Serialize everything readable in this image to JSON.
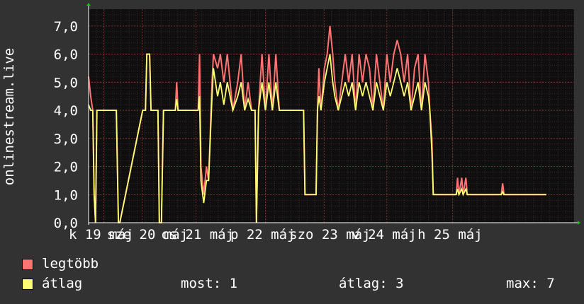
{
  "chart_data": {
    "type": "area",
    "ylabel": "onlinestream.live",
    "ylim": [
      0,
      7.6
    ],
    "yticks": [
      0,
      1,
      2,
      3,
      4,
      5,
      6,
      7
    ],
    "ytick_labels": [
      "0,0",
      "1,0",
      "2,0",
      "3,0",
      "4,0",
      "5,0",
      "6,0",
      "7,0"
    ],
    "xlim": [
      0,
      7.0
    ],
    "xtick_labels": [
      {
        "x": 0.02,
        "label": "k 19 máj"
      },
      {
        "x": 0.57,
        "label": "sze 20 máj"
      },
      {
        "x": 1.35,
        "label": "cs 21 máj"
      },
      {
        "x": 2.35,
        "label": "p 22 máj"
      },
      {
        "x": 3.2,
        "label": "szo 23 máj"
      },
      {
        "x": 4.1,
        "label": "v 24 máj"
      },
      {
        "x": 5.05,
        "label": "h 25 máj"
      }
    ],
    "grid": true,
    "colors": {
      "legtobb": "#ff7373",
      "atlag": "#ffff73"
    },
    "series": [
      {
        "name": "legtöbb",
        "color": "#ff7373",
        "points": [
          [
            0.0,
            5.2
          ],
          [
            0.03,
            4.5
          ],
          [
            0.06,
            4.0
          ],
          [
            0.08,
            1.0
          ],
          [
            0.1,
            0.0
          ],
          [
            0.12,
            4.0
          ],
          [
            0.4,
            4.0
          ],
          [
            0.43,
            0.0
          ],
          [
            0.45,
            0.0
          ],
          [
            0.78,
            4.0
          ],
          [
            0.82,
            4.0
          ],
          [
            0.84,
            6.0
          ],
          [
            0.88,
            6.0
          ],
          [
            0.9,
            4.0
          ],
          [
            1.0,
            4.0
          ],
          [
            1.02,
            0.0
          ],
          [
            1.05,
            0.0
          ],
          [
            1.08,
            4.0
          ],
          [
            1.25,
            4.0
          ],
          [
            1.27,
            5.0
          ],
          [
            1.29,
            4.0
          ],
          [
            1.58,
            4.0
          ],
          [
            1.6,
            6.0
          ],
          [
            1.62,
            2.0
          ],
          [
            1.66,
            1.0
          ],
          [
            1.7,
            2.0
          ],
          [
            1.73,
            1.5
          ],
          [
            1.78,
            5.0
          ],
          [
            1.8,
            6.0
          ],
          [
            1.86,
            5.5
          ],
          [
            1.9,
            6.0
          ],
          [
            1.95,
            5.0
          ],
          [
            2.0,
            6.0
          ],
          [
            2.08,
            4.0
          ],
          [
            2.15,
            5.0
          ],
          [
            2.2,
            6.0
          ],
          [
            2.25,
            4.0
          ],
          [
            2.3,
            5.0
          ],
          [
            2.35,
            4.0
          ],
          [
            2.4,
            4.0
          ],
          [
            2.42,
            0.0
          ],
          [
            2.45,
            4.0
          ],
          [
            2.5,
            6.0
          ],
          [
            2.55,
            4.0
          ],
          [
            2.6,
            6.0
          ],
          [
            2.65,
            4.0
          ],
          [
            2.7,
            6.0
          ],
          [
            2.75,
            4.0
          ],
          [
            3.1,
            4.0
          ],
          [
            3.12,
            1.0
          ],
          [
            3.28,
            1.0
          ],
          [
            3.3,
            4.0
          ],
          [
            3.32,
            5.5
          ],
          [
            3.35,
            4.0
          ],
          [
            3.4,
            5.5
          ],
          [
            3.44,
            6.0
          ],
          [
            3.48,
            7.0
          ],
          [
            3.52,
            6.0
          ],
          [
            3.55,
            5.0
          ],
          [
            3.6,
            4.0
          ],
          [
            3.65,
            5.0
          ],
          [
            3.7,
            6.0
          ],
          [
            3.75,
            5.0
          ],
          [
            3.8,
            6.0
          ],
          [
            3.85,
            4.0
          ],
          [
            3.9,
            6.0
          ],
          [
            3.95,
            5.0
          ],
          [
            4.0,
            6.0
          ],
          [
            4.05,
            5.5
          ],
          [
            4.1,
            4.0
          ],
          [
            4.15,
            6.0
          ],
          [
            4.2,
            5.0
          ],
          [
            4.25,
            4.0
          ],
          [
            4.3,
            6.0
          ],
          [
            4.35,
            5.0
          ],
          [
            4.4,
            6.0
          ],
          [
            4.45,
            6.5
          ],
          [
            4.5,
            6.0
          ],
          [
            4.55,
            5.0
          ],
          [
            4.6,
            6.0
          ],
          [
            4.65,
            4.0
          ],
          [
            4.7,
            5.5
          ],
          [
            4.75,
            6.0
          ],
          [
            4.8,
            4.0
          ],
          [
            4.85,
            6.0
          ],
          [
            4.9,
            5.0
          ],
          [
            4.92,
            4.0
          ],
          [
            4.95,
            3.0
          ],
          [
            4.97,
            1.0
          ],
          [
            5.0,
            1.0
          ],
          [
            5.3,
            1.0
          ],
          [
            5.32,
            1.6
          ],
          [
            5.34,
            1.0
          ],
          [
            5.38,
            1.6
          ],
          [
            5.4,
            1.0
          ],
          [
            5.44,
            1.6
          ],
          [
            5.46,
            1.0
          ],
          [
            5.95,
            1.0
          ],
          [
            5.97,
            1.4
          ],
          [
            5.99,
            1.0
          ],
          [
            6.6,
            1.0
          ]
        ]
      },
      {
        "name": "átlag",
        "color": "#ffff73",
        "points": [
          [
            0.0,
            4.2
          ],
          [
            0.03,
            4.0
          ],
          [
            0.06,
            4.0
          ],
          [
            0.08,
            1.0
          ],
          [
            0.1,
            0.0
          ],
          [
            0.12,
            4.0
          ],
          [
            0.4,
            4.0
          ],
          [
            0.43,
            0.0
          ],
          [
            0.45,
            0.0
          ],
          [
            0.78,
            4.0
          ],
          [
            0.82,
            4.0
          ],
          [
            0.84,
            6.0
          ],
          [
            0.88,
            6.0
          ],
          [
            0.9,
            4.0
          ],
          [
            1.0,
            4.0
          ],
          [
            1.02,
            0.0
          ],
          [
            1.05,
            0.0
          ],
          [
            1.08,
            4.0
          ],
          [
            1.25,
            4.0
          ],
          [
            1.27,
            4.4
          ],
          [
            1.29,
            4.0
          ],
          [
            1.58,
            4.0
          ],
          [
            1.6,
            4.5
          ],
          [
            1.62,
            1.5
          ],
          [
            1.66,
            0.7
          ],
          [
            1.7,
            1.5
          ],
          [
            1.73,
            1.5
          ],
          [
            1.78,
            4.5
          ],
          [
            1.8,
            5.5
          ],
          [
            1.86,
            4.5
          ],
          [
            1.9,
            5.0
          ],
          [
            1.95,
            4.2
          ],
          [
            2.0,
            5.0
          ],
          [
            2.08,
            4.0
          ],
          [
            2.15,
            4.5
          ],
          [
            2.2,
            5.0
          ],
          [
            2.25,
            4.0
          ],
          [
            2.3,
            4.4
          ],
          [
            2.35,
            4.0
          ],
          [
            2.4,
            4.0
          ],
          [
            2.42,
            0.0
          ],
          [
            2.45,
            4.0
          ],
          [
            2.5,
            5.0
          ],
          [
            2.55,
            4.0
          ],
          [
            2.6,
            5.0
          ],
          [
            2.65,
            4.0
          ],
          [
            2.7,
            5.0
          ],
          [
            2.75,
            4.0
          ],
          [
            3.1,
            4.0
          ],
          [
            3.12,
            1.0
          ],
          [
            3.28,
            1.0
          ],
          [
            3.3,
            4.0
          ],
          [
            3.32,
            4.5
          ],
          [
            3.35,
            4.0
          ],
          [
            3.4,
            5.0
          ],
          [
            3.44,
            5.5
          ],
          [
            3.48,
            6.0
          ],
          [
            3.52,
            5.0
          ],
          [
            3.55,
            4.5
          ],
          [
            3.6,
            4.0
          ],
          [
            3.65,
            4.5
          ],
          [
            3.7,
            5.0
          ],
          [
            3.75,
            4.5
          ],
          [
            3.8,
            5.0
          ],
          [
            3.85,
            4.0
          ],
          [
            3.9,
            5.0
          ],
          [
            3.95,
            4.5
          ],
          [
            4.0,
            5.0
          ],
          [
            4.05,
            4.5
          ],
          [
            4.1,
            4.0
          ],
          [
            4.15,
            5.0
          ],
          [
            4.2,
            4.5
          ],
          [
            4.25,
            4.0
          ],
          [
            4.3,
            5.0
          ],
          [
            4.35,
            4.5
          ],
          [
            4.4,
            5.0
          ],
          [
            4.45,
            5.5
          ],
          [
            4.5,
            5.0
          ],
          [
            4.55,
            4.5
          ],
          [
            4.6,
            5.0
          ],
          [
            4.65,
            4.0
          ],
          [
            4.7,
            4.5
          ],
          [
            4.75,
            5.0
          ],
          [
            4.8,
            4.0
          ],
          [
            4.85,
            5.0
          ],
          [
            4.9,
            4.5
          ],
          [
            4.92,
            4.0
          ],
          [
            4.95,
            2.5
          ],
          [
            4.97,
            1.0
          ],
          [
            5.0,
            1.0
          ],
          [
            5.3,
            1.0
          ],
          [
            5.32,
            1.2
          ],
          [
            5.34,
            1.0
          ],
          [
            5.38,
            1.2
          ],
          [
            5.4,
            1.0
          ],
          [
            5.44,
            1.2
          ],
          [
            5.46,
            1.0
          ],
          [
            5.95,
            1.0
          ],
          [
            5.97,
            1.1
          ],
          [
            5.99,
            1.0
          ],
          [
            6.6,
            1.0
          ]
        ]
      }
    ]
  },
  "legend": {
    "items": [
      {
        "label": "legtöbb",
        "color": "#ff7373"
      },
      {
        "label": "átlag",
        "color": "#ffff73"
      }
    ],
    "stats": {
      "most": "most: 1",
      "atlag": "átlag: 3",
      "max": "max: 7"
    }
  }
}
